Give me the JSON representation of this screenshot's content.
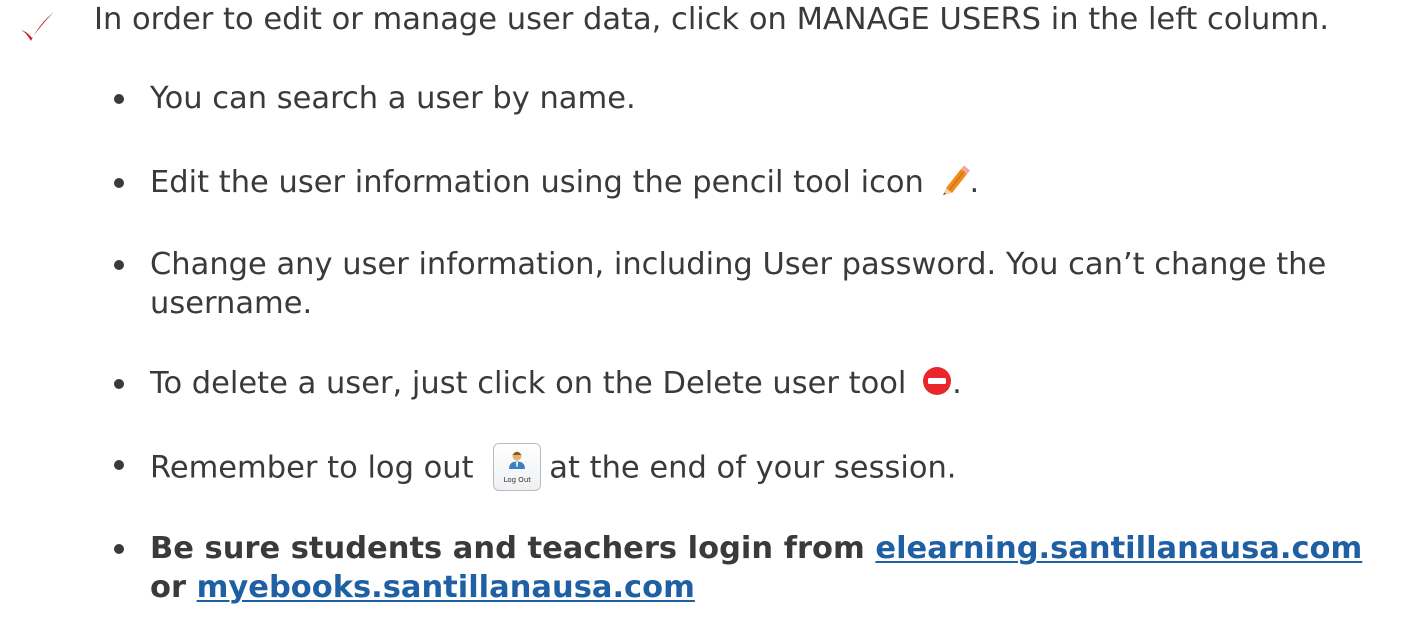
{
  "colors": {
    "check": "#c8202a",
    "text": "#3a3a3a",
    "link": "#1f5fa3",
    "delete": "#e8262b"
  },
  "intro": {
    "text": "In order to edit or manage user data, click on MANAGE USERS in the left column."
  },
  "bullets": {
    "search": "You can search a user by name.",
    "edit_before": "Edit the user information using the pencil tool icon",
    "edit_after": ".",
    "change": "Change any user information, including User password. You can’t change the username.",
    "delete_before": "To delete a user, just click on the Delete user tool",
    "delete_after": ".",
    "logout_before": "Remember to log out",
    "logout_after": "at the end of your session.",
    "logout_icon_label": "Log Out",
    "login_before": "Be sure students and teachers login from",
    "login_link1": "elearning.santillanausa.com",
    "login_or": "or",
    "login_link2": "myebooks.santillanausa.com"
  },
  "icons": {
    "check": "checkmark-icon",
    "pencil": "pencil-icon",
    "delete": "delete-user-icon",
    "logout": "logout-icon"
  }
}
